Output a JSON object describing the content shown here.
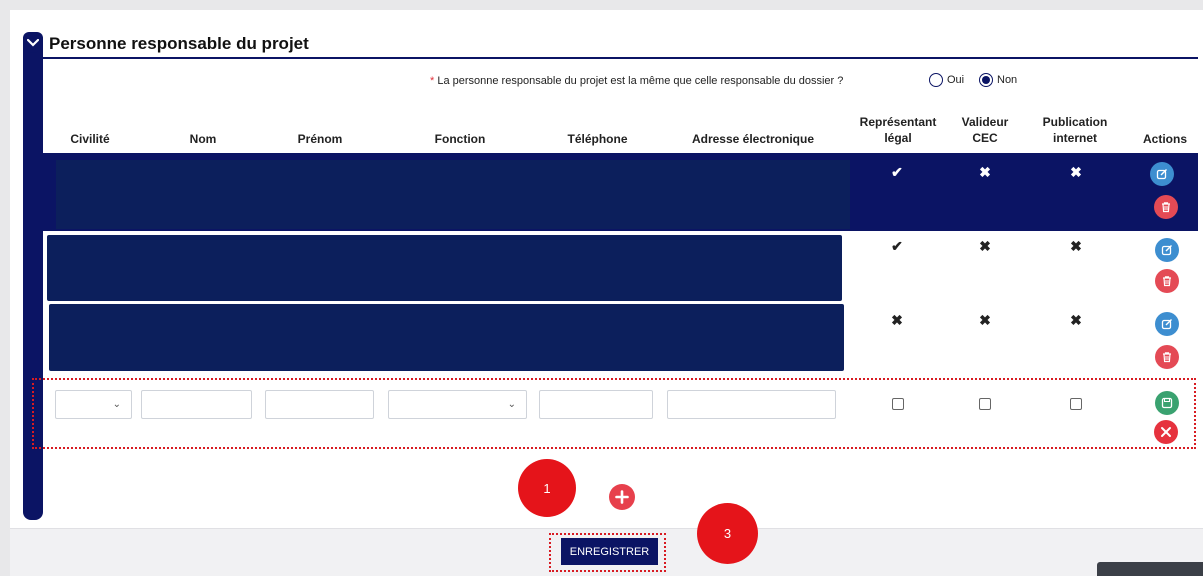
{
  "section": {
    "title": "Personne responsable du projet"
  },
  "question": {
    "required_marker": "*",
    "text": "La personne responsable du projet est la même que celle responsable du dossier ?",
    "options": [
      {
        "label": "Oui",
        "selected": false
      },
      {
        "label": "Non",
        "selected": true
      }
    ]
  },
  "table": {
    "headers": {
      "civilite": "Civilité",
      "nom": "Nom",
      "prenom": "Prénom",
      "fonction": "Fonction",
      "telephone": "Téléphone",
      "email": "Adresse électronique",
      "rep_line1": "Représentant",
      "rep_line2": "légal",
      "val_line1": "Valideur",
      "val_line2": "CEC",
      "pub_line1": "Publication",
      "pub_line2": "internet",
      "actions": "Actions"
    },
    "rows": [
      {
        "representant_legal": "yes",
        "valideur_cec": "no",
        "publication_internet": "no",
        "selected": true
      },
      {
        "representant_legal": "yes",
        "valideur_cec": "no",
        "publication_internet": "no",
        "selected": false
      },
      {
        "representant_legal": "no",
        "valideur_cec": "no",
        "publication_internet": "no",
        "selected": false
      }
    ],
    "new_row": {
      "civilite": "",
      "nom": "",
      "prenom": "",
      "fonction": "",
      "telephone": "",
      "email": "",
      "representant_legal": false,
      "valideur_cec": false,
      "publication_internet": false
    }
  },
  "icons": {
    "check": "✔",
    "cross": "✖"
  },
  "annotations": [
    "1",
    "3"
  ],
  "save_button": {
    "label": "ENREGISTRER"
  },
  "colors": {
    "primary": "#0b1464",
    "redacted": "#0c1f5c",
    "edit": "#3d8ed0",
    "delete": "#e44a55",
    "save": "#3aa270",
    "annotation": "#e5141a"
  }
}
